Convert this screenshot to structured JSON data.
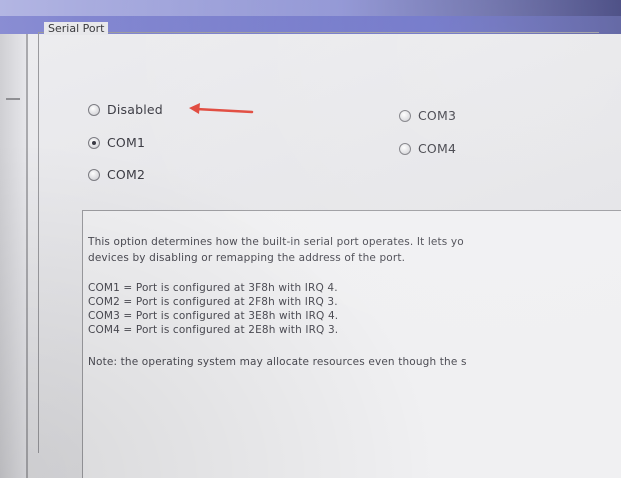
{
  "group": {
    "legend": "Serial Port"
  },
  "options": {
    "disabled": {
      "label": "Disabled",
      "selected": false
    },
    "com1": {
      "label": "COM1",
      "selected": true
    },
    "com2": {
      "label": "COM2",
      "selected": false
    },
    "com3": {
      "label": "COM3",
      "selected": false
    },
    "com4": {
      "label": "COM4",
      "selected": false
    }
  },
  "annotation": {
    "arrow_color": "#e0463a"
  },
  "help": {
    "line1": "This option determines how the built-in serial port operates. It lets yo",
    "line2": "devices by disabling or remapping the address of the port.",
    "com1": "COM1 = Port is configured at 3F8h with IRQ 4.",
    "com2": "COM2 = Port is configured at 2F8h with IRQ 3.",
    "com3": "COM3 = Port is configured at 3E8h with IRQ 4.",
    "com4": "COM4 = Port is configured at 2E8h with IRQ 3.",
    "note": "Note: the operating system may allocate resources even though the s"
  }
}
